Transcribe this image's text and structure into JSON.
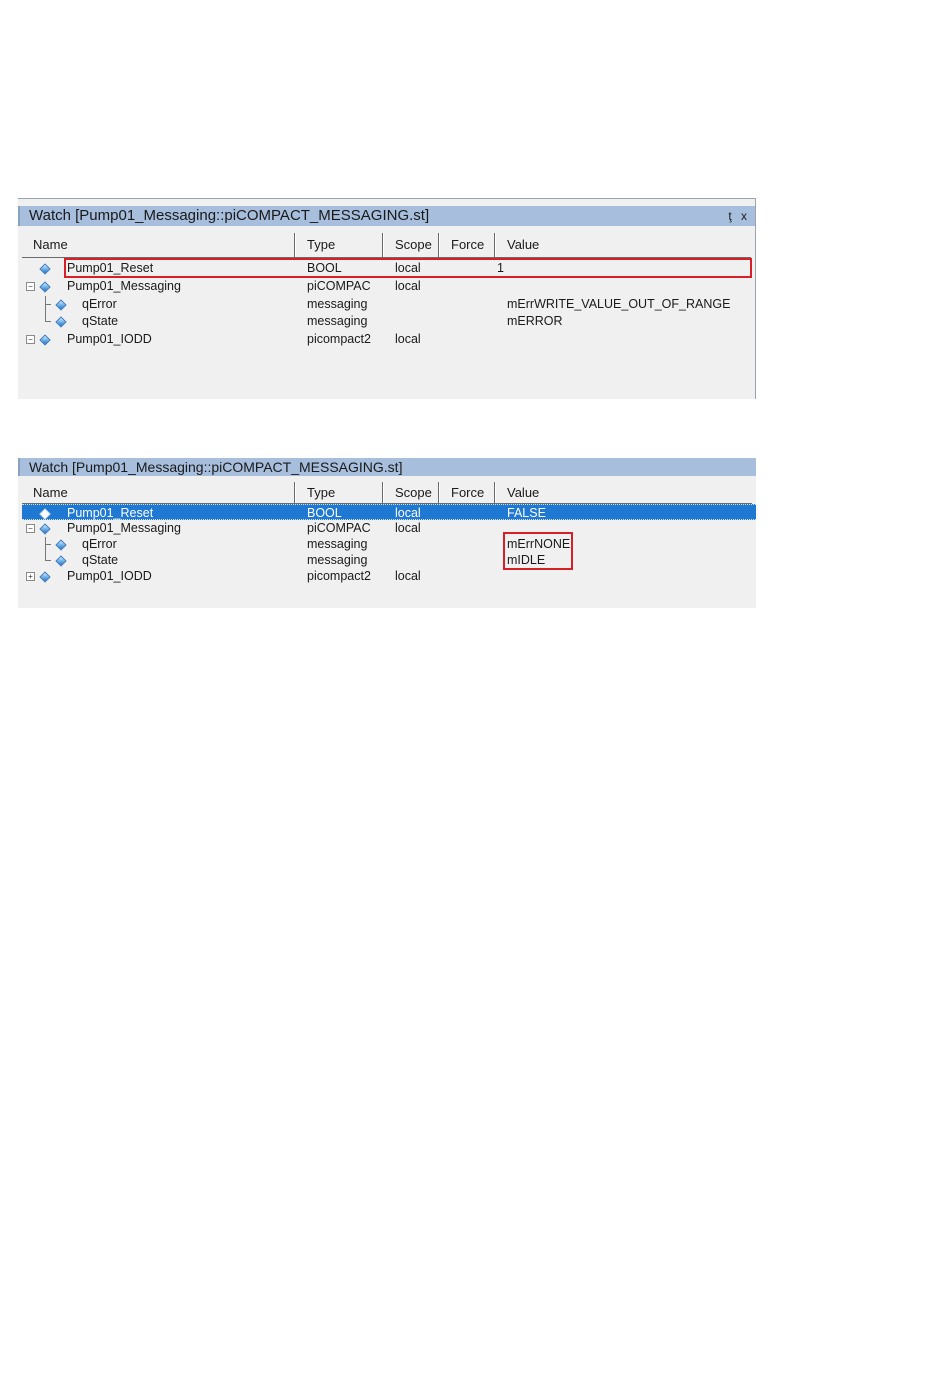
{
  "columns": {
    "name": "Name",
    "type": "Type",
    "scope": "Scope",
    "force": "Force",
    "value": "Value"
  },
  "watch1": {
    "title": "Watch [Pump01_Messaging::piCOMPACT_MESSAGING.st]",
    "pin_label": "ţ",
    "close_label": "x",
    "rows": [
      {
        "name": "Pump01_Reset",
        "type": "BOOL",
        "scope": "local",
        "value": "1"
      },
      {
        "name": "Pump01_Messaging",
        "type": "piCOMPAC",
        "scope": "local",
        "value": "",
        "expander": "−"
      },
      {
        "name": "qError",
        "type": "messaging",
        "scope": "",
        "value": "mErrWRITE_VALUE_OUT_OF_RANGE"
      },
      {
        "name": "qState",
        "type": "messaging",
        "scope": "",
        "value": "mERROR"
      },
      {
        "name": "Pump01_IODD",
        "type": "picompact2",
        "scope": "local",
        "value": "",
        "expander": "−"
      }
    ]
  },
  "watch2": {
    "title": "Watch [Pump01_Messaging::piCOMPACT_MESSAGING.st]",
    "rows": [
      {
        "name": "Pump01_Reset",
        "type": "BOOL",
        "scope": "local",
        "value": "FALSE"
      },
      {
        "name": "Pump01_Messaging",
        "type": "piCOMPAC",
        "scope": "local",
        "value": "",
        "expander": "−"
      },
      {
        "name": "qError",
        "type": "messaging",
        "scope": "",
        "value": "mErrNONE"
      },
      {
        "name": "qState",
        "type": "messaging",
        "scope": "",
        "value": "mIDLE"
      },
      {
        "name": "Pump01_IODD",
        "type": "picompact2",
        "scope": "local",
        "value": "",
        "expander": "+"
      }
    ]
  },
  "colors": {
    "titlebar": "#a7bfdd",
    "selection": "#1f78d1",
    "highlight_box": "#d61f26",
    "icon": "#5aa7e6"
  },
  "icons": {
    "variable": "diamond-icon",
    "expand": "plus-box-icon",
    "collapse": "minus-box-icon",
    "pin": "pin-icon",
    "close": "close-icon"
  }
}
